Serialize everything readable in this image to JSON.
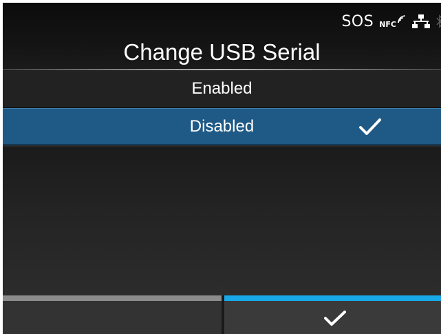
{
  "status": {
    "sos_label": "SOS",
    "nfc_label": "NFC",
    "icons": [
      "nfc-icon",
      "network-icon",
      "bluetooth-icon"
    ]
  },
  "title": "Change USB Serial",
  "options": [
    {
      "label": "Enabled",
      "selected": false
    },
    {
      "label": "Disabled",
      "selected": true
    }
  ],
  "softkeys": {
    "left_icon": "none",
    "right_icon": "check-icon"
  },
  "colors": {
    "selected_row": "#1f5a86",
    "right_key_bar": "#18a8e8",
    "left_key_bar": "#8c8c8c"
  }
}
